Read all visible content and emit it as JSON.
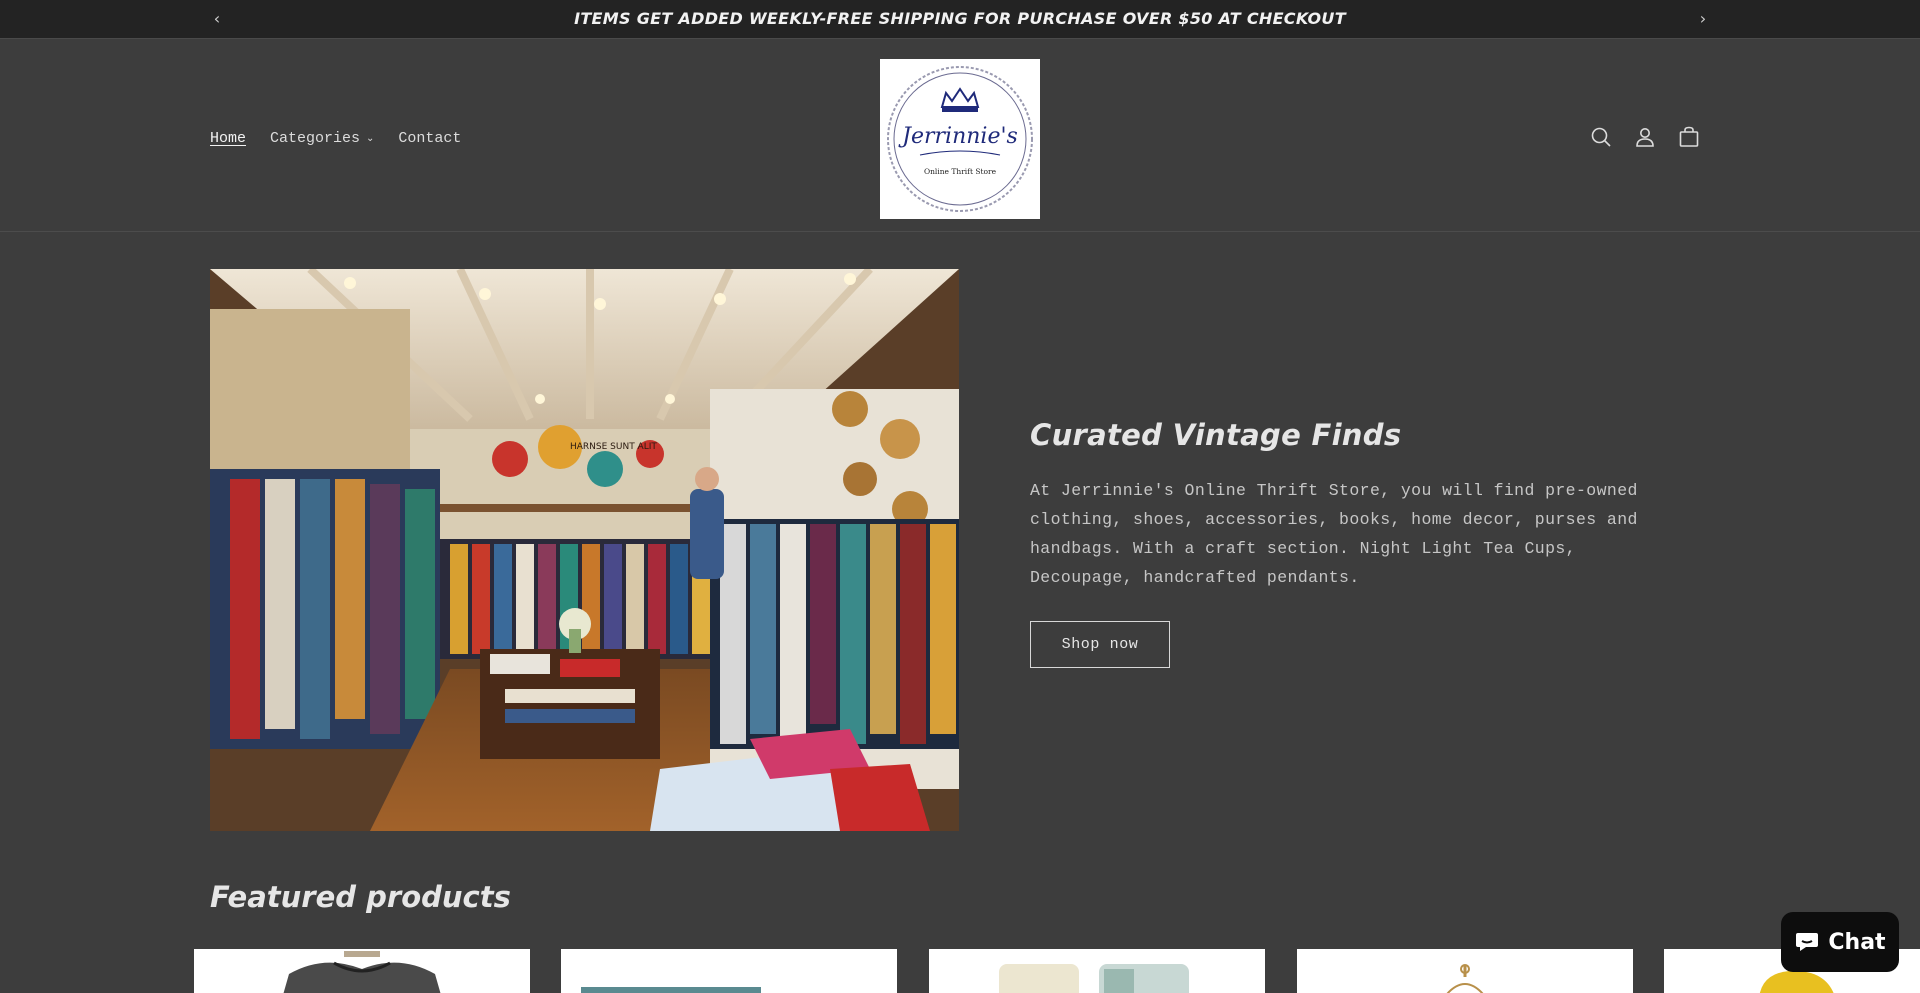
{
  "announcement": {
    "text": "ITEMS GET ADDED WEEKLY-FREE SHIPPING FOR PURCHASE OVER $50 AT CHECKOUT",
    "prev_icon": "chevron-left-icon",
    "next_icon": "chevron-right-icon"
  },
  "header": {
    "nav": {
      "home": "Home",
      "categories": "Categories",
      "contact": "Contact"
    },
    "logo": {
      "name": "Jerrinnie's",
      "tagline": "Online Thrift Store"
    },
    "icons": [
      "search-icon",
      "account-icon",
      "cart-icon"
    ]
  },
  "hero": {
    "title": "Curated Vintage Finds",
    "description": "At Jerrinnie's Online Thrift Store, you will find pre-owned clothing, shoes, accessories, books, home decor, purses and handbags. With a craft section. Night Light Tea Cups, Decoupage, handcrafted pendants.",
    "button_label": "Shop now",
    "sign_text": "HARNSE SUNT ALIT"
  },
  "featured": {
    "title": "Featured products"
  },
  "chat": {
    "label": "Chat"
  },
  "colors": {
    "background": "#3d3d3d",
    "announcement_bar": "#232323",
    "chat_button": "#0d0d0d",
    "logo_ink": "#1f2a7a"
  }
}
